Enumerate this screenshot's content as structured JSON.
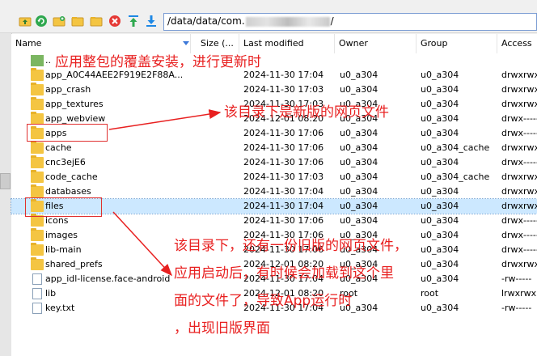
{
  "path": {
    "prefix": "/data/data/com.",
    "suffix": "/"
  },
  "toolbar": {
    "icons": [
      "up-folder-icon",
      "refresh-icon",
      "new-folder-icon",
      "folder-icon",
      "delete-icon",
      "upload-icon",
      "download-icon"
    ],
    "colors": {
      "refresh": "#2fa84f",
      "delete": "#e53935",
      "upload": "#1e88e5",
      "download": "#1e88e5"
    }
  },
  "columns": [
    "Name",
    "Size (...",
    "Last modified",
    "Owner",
    "Group",
    "Access"
  ],
  "rows": [
    {
      "name": "..",
      "size": "",
      "date": "",
      "owner": "",
      "group": "",
      "access": "",
      "type": "up"
    },
    {
      "name": "app_A0C44AEE2F919E2F88A...",
      "date": "2024-11-30 17:04",
      "owner": "u0_a304",
      "group": "u0_a304",
      "access": "drwxrwx",
      "type": "folder"
    },
    {
      "name": "app_crash",
      "date": "2024-11-30 17:03",
      "owner": "u0_a304",
      "group": "u0_a304",
      "access": "drwxrwx",
      "type": "folder"
    },
    {
      "name": "app_textures",
      "date": "2024-11-30 17:03",
      "owner": "u0_a304",
      "group": "u0_a304",
      "access": "drwxrwx",
      "type": "folder"
    },
    {
      "name": "app_webview",
      "date": "2024-12-01 08:20",
      "owner": "u0_a304",
      "group": "u0_a304",
      "access": "drwx-----",
      "type": "folder"
    },
    {
      "name": "apps",
      "date": "2024-11-30 17:06",
      "owner": "u0_a304",
      "group": "u0_a304",
      "access": "drwx-----",
      "type": "folder"
    },
    {
      "name": "cache",
      "date": "2024-11-30 17:06",
      "owner": "u0_a304",
      "group": "u0_a304_cache",
      "access": "drwxrwxs",
      "type": "folder"
    },
    {
      "name": "cnc3ejE6",
      "date": "2024-11-30 17:06",
      "owner": "u0_a304",
      "group": "u0_a304",
      "access": "drwx-----",
      "type": "folder"
    },
    {
      "name": "code_cache",
      "date": "2024-11-30 17:03",
      "owner": "u0_a304",
      "group": "u0_a304_cache",
      "access": "drwxrwxs",
      "type": "folder"
    },
    {
      "name": "databases",
      "date": "2024-11-30 17:04",
      "owner": "u0_a304",
      "group": "u0_a304",
      "access": "drwxrwx",
      "type": "folder"
    },
    {
      "name": "files",
      "date": "2024-11-30 17:04",
      "owner": "u0_a304",
      "group": "u0_a304",
      "access": "drwxrwx",
      "type": "folder"
    },
    {
      "name": "icons",
      "date": "2024-11-30 17:06",
      "owner": "u0_a304",
      "group": "u0_a304",
      "access": "drwx-----",
      "type": "folder"
    },
    {
      "name": "images",
      "date": "2024-11-30 17:06",
      "owner": "u0_a304",
      "group": "u0_a304",
      "access": "drwx-----",
      "type": "folder"
    },
    {
      "name": "lib-main",
      "date": "2024-11-30 17:06",
      "owner": "u0_a304",
      "group": "u0_a304",
      "access": "drwx-----",
      "type": "folder"
    },
    {
      "name": "shared_prefs",
      "date": "2024-12-01 08:20",
      "owner": "u0_a304",
      "group": "u0_a304",
      "access": "drwxrwx",
      "type": "folder"
    },
    {
      "name": "app_idl-license.face-android",
      "date": "2024-11-30 17:04",
      "owner": "u0_a304",
      "group": "u0_a304",
      "access": "-rw-----",
      "type": "file"
    },
    {
      "name": "lib",
      "date": "2024-12-01 08:20",
      "owner": "root",
      "group": "root",
      "access": "lrwxrwx",
      "type": "link"
    },
    {
      "name": "key.txt",
      "date": "2024-11-30 17:04",
      "owner": "u0_a304",
      "group": "u0_a304",
      "access": "-rw-----",
      "type": "txt"
    }
  ],
  "annotations": {
    "a1": "应用整包的覆盖安装，进行更新时",
    "a2": "该目录下是新版的网页文件",
    "a3_l1": "该目录下，还有一份旧版的网页文件，",
    "a3_l2": "应用启动后，有时候会加载到这个里",
    "a3_l3": "面的文件了，导致App运行时",
    "a3_l4": "，出现旧版界面"
  },
  "annotation_color": "#e82020"
}
